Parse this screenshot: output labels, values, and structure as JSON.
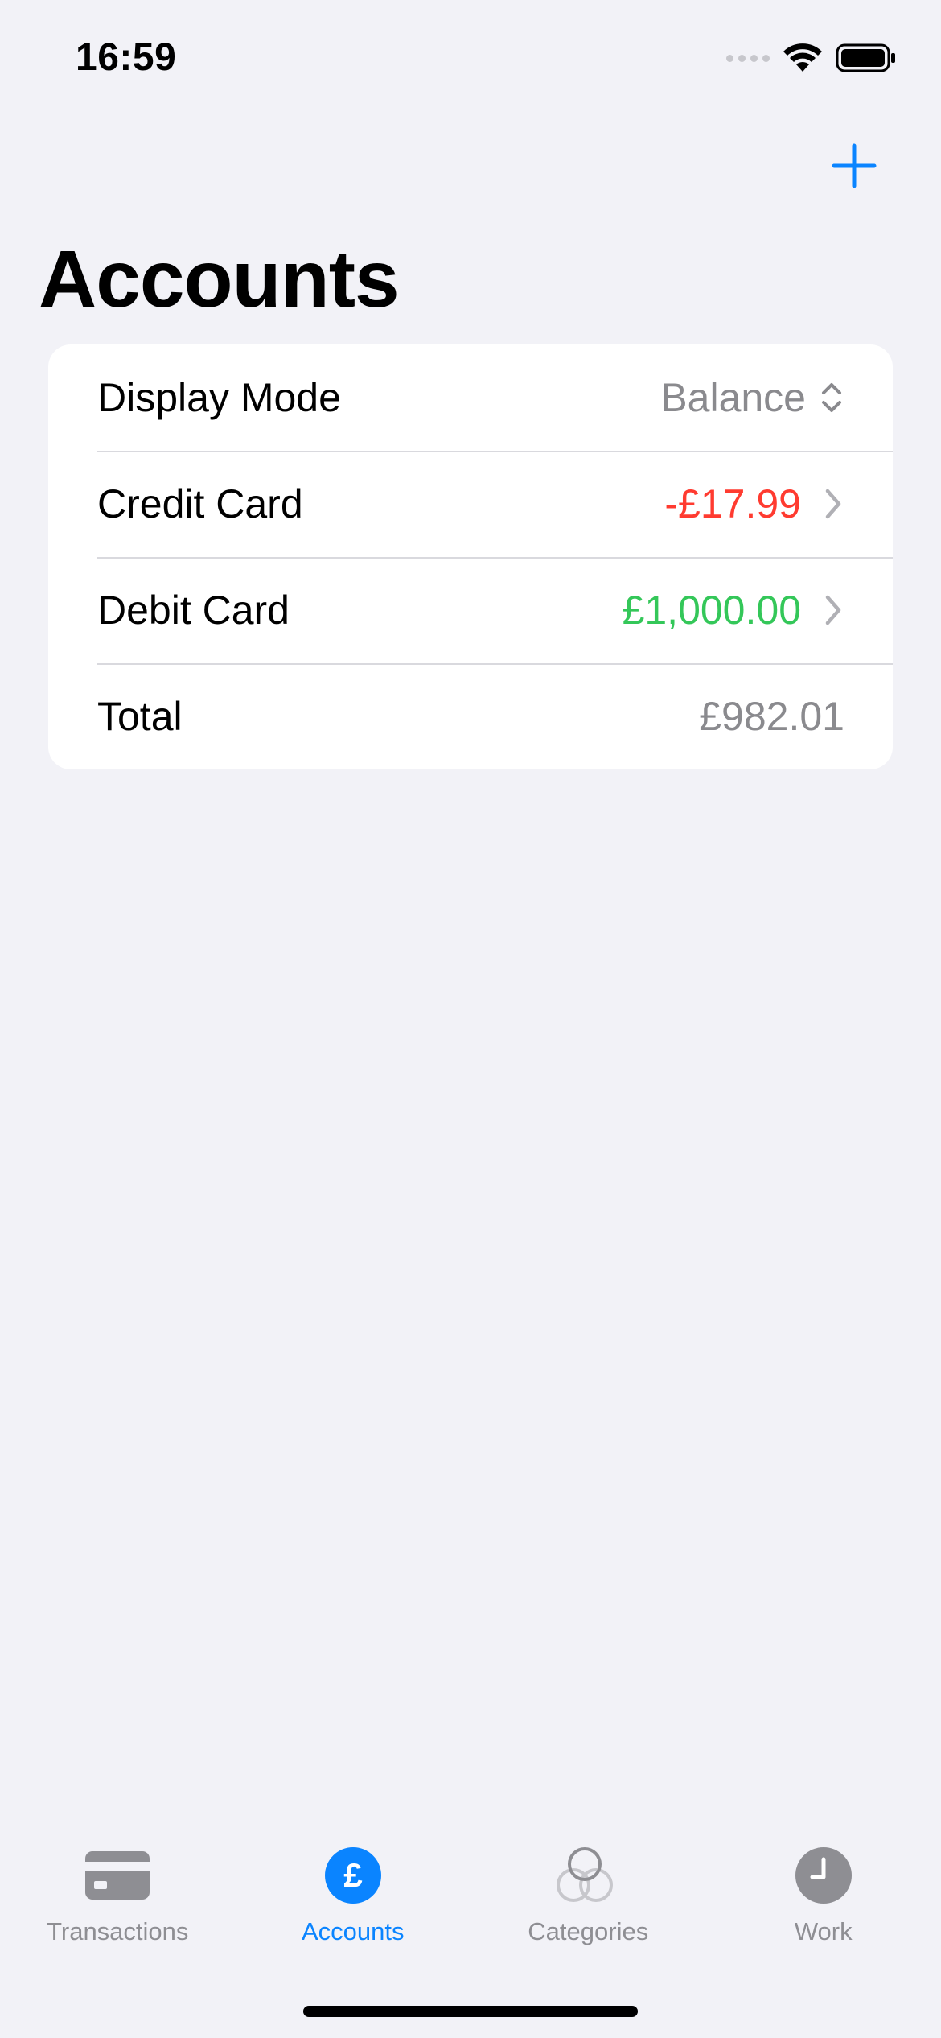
{
  "status_bar": {
    "time": "16:59"
  },
  "nav": {
    "title": "Accounts",
    "add_icon": "plus-icon",
    "accent_color": "#0a84ff"
  },
  "list": {
    "display_mode": {
      "label": "Display Mode",
      "value": "Balance",
      "icon": "chevron-up-down-icon"
    },
    "accounts": [
      {
        "name": "Credit Card",
        "amount": "-£17.99",
        "color": "#ff3b30"
      },
      {
        "name": "Debit Card",
        "amount": "£1,000.00",
        "color": "#34c759"
      }
    ],
    "total": {
      "label": "Total",
      "value": "£982.01"
    }
  },
  "tab_bar": {
    "tabs": [
      {
        "label": "Transactions",
        "icon": "credit-card-icon",
        "active": false
      },
      {
        "label": "Accounts",
        "icon": "pound-circle-icon",
        "active": true
      },
      {
        "label": "Categories",
        "icon": "circles-icon",
        "active": false
      },
      {
        "label": "Work",
        "icon": "clock-icon",
        "active": false
      }
    ]
  }
}
